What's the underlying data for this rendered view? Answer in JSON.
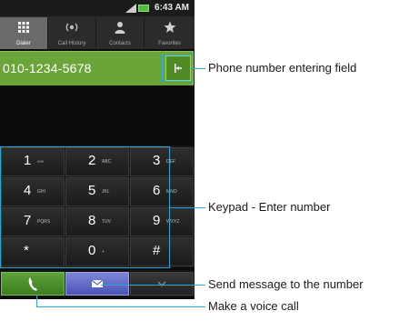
{
  "status_bar": {
    "time": "6:43 AM"
  },
  "tabs": [
    {
      "label": "Dialer",
      "icon": "keypad-icon",
      "active": true
    },
    {
      "label": "Call History",
      "icon": "call-history-icon",
      "active": false
    },
    {
      "label": "Contacts",
      "icon": "contacts-icon",
      "active": false
    },
    {
      "label": "Favorites",
      "icon": "star-icon",
      "active": false
    }
  ],
  "number_field": {
    "value": "010-1234-5678",
    "delete_icon": "backspace-icon"
  },
  "keypad": {
    "keys": [
      {
        "digit": "1",
        "letters": "∞∞"
      },
      {
        "digit": "2",
        "letters": "ABC"
      },
      {
        "digit": "3",
        "letters": "DEF"
      },
      {
        "digit": "4",
        "letters": "GHI"
      },
      {
        "digit": "5",
        "letters": "JKL"
      },
      {
        "digit": "6",
        "letters": "MNO"
      },
      {
        "digit": "7",
        "letters": "PQRS"
      },
      {
        "digit": "8",
        "letters": "TUV"
      },
      {
        "digit": "9",
        "letters": "WXYZ"
      },
      {
        "digit": "*",
        "letters": ""
      },
      {
        "digit": "0",
        "letters": "+"
      },
      {
        "digit": "#",
        "letters": ""
      }
    ]
  },
  "bottom_bar": {
    "call_icon": "phone-icon",
    "message_icon": "envelope-icon",
    "hide_icon": "chevron-down-icon"
  },
  "annotations": {
    "number_field": "Phone number entering field",
    "keypad": "Keypad - Enter number",
    "send_message": "Send message to the number",
    "voice_call": "Make a voice call"
  },
  "colors": {
    "field_green": "#6ba53a",
    "call_green": "#4c8e2b",
    "message_blue": "#5f66c8",
    "callout_blue": "#2aa9d8"
  }
}
